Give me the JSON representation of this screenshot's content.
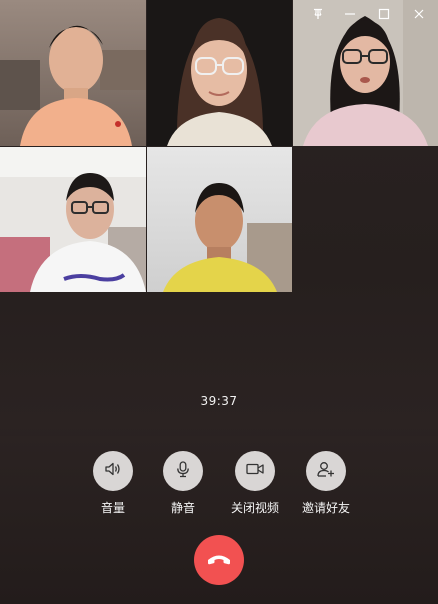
{
  "window_controls": {
    "pin": "pin-icon",
    "minimize": "minimize-icon",
    "maximize": "maximize-icon",
    "close": "close-icon"
  },
  "participants": [
    {
      "id": "p1",
      "shirt_color": "#f2b08c"
    },
    {
      "id": "p2",
      "shirt_color": "#e9e2d6"
    },
    {
      "id": "p3",
      "shirt_color": "#e8c9cf"
    },
    {
      "id": "p4",
      "shirt_color": "#f6f6f6"
    },
    {
      "id": "p5",
      "shirt_color": "#e4d44a"
    }
  ],
  "call": {
    "timer": "39:37"
  },
  "controls": [
    {
      "key": "volume",
      "label": "音量",
      "icon": "speaker-icon"
    },
    {
      "key": "mute",
      "label": "静音",
      "icon": "microphone-icon"
    },
    {
      "key": "video",
      "label": "关闭视频",
      "icon": "video-camera-icon"
    },
    {
      "key": "invite",
      "label": "邀请好友",
      "icon": "add-user-icon"
    }
  ],
  "hangup": {
    "icon": "phone-hangup-icon",
    "color": "#f25151"
  }
}
